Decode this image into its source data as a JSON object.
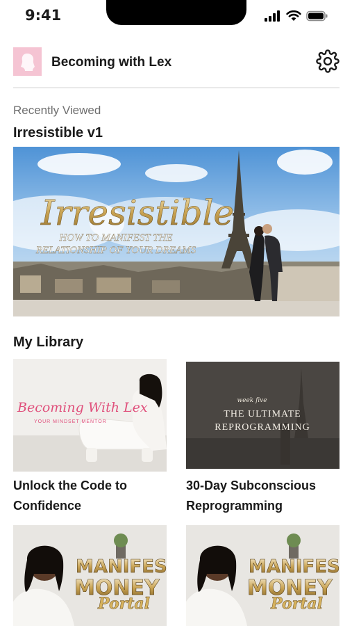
{
  "status_bar": {
    "time": "9:41"
  },
  "header": {
    "brand": "Becoming with Lex"
  },
  "recent": {
    "section_label": "Recently Viewed",
    "title": "Irresistible v1",
    "banner": {
      "script_title": "Irresistible",
      "subtitle_line1": "HOW TO MANIFEST THE",
      "subtitle_line2": "RELATIONSHIP OF YOUR DREAMS"
    }
  },
  "library": {
    "title": "My Library",
    "items": [
      {
        "title_line1": "Unlock the Code to",
        "title_line2": "Confidence",
        "thumb_script": "Becoming With Lex",
        "thumb_caption": "YOUR MINDSET MENTOR"
      },
      {
        "title_line1": "30-Day Subconscious",
        "title_line2": "Reprogramming",
        "thumb_small": "week five",
        "thumb_line1": "THE ULTIMATE",
        "thumb_line2": "REPROGRAMMING"
      },
      {
        "thumb_word1": "MANIFEST",
        "thumb_word2": "MONEY",
        "thumb_script": "Portal"
      },
      {
        "thumb_word1": "MANIFEST",
        "thumb_word2": "MONEY",
        "thumb_script": "Portal"
      }
    ]
  },
  "colors": {
    "avatar_bg": "#f5c4d3",
    "divider": "#e9e9e9",
    "muted_text": "#6e6e6e",
    "dark_thumb": "#4a4642",
    "gold": "#c9a352"
  }
}
